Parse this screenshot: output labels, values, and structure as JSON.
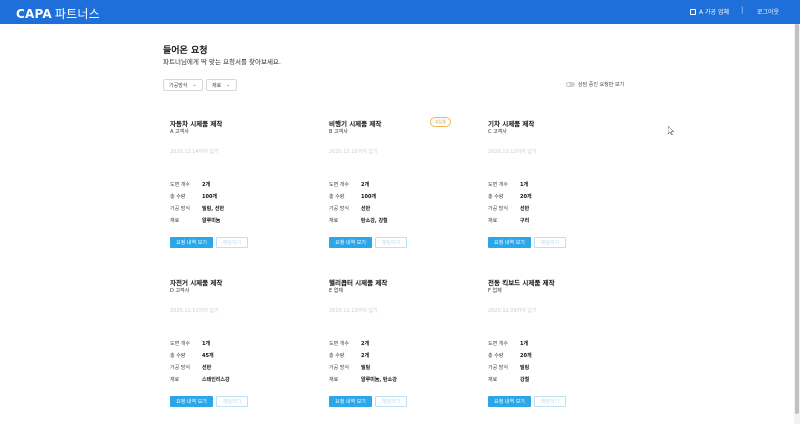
{
  "header": {
    "logo_main": "CAPA",
    "logo_sub": "파트너스",
    "company_label": "A 가공 업체",
    "separator": "|",
    "logout_label": "로그아웃"
  },
  "page": {
    "title": "들어온 요청",
    "subtitle": "파트너님에게 딱 맞는 요청서를 찾아보세요."
  },
  "filters": {
    "method_label": "가공방식",
    "material_label": "재료",
    "toggle_label": "상담 중인 요청만 보기"
  },
  "spec_labels": {
    "drawings": "도면 개수",
    "total_qty": "총 수량",
    "method": "가공 방식",
    "material": "재료"
  },
  "buttons": {
    "detail": "요청 내역 보기",
    "chat": "채팅하기"
  },
  "cards": [
    {
      "title": "자동차 시제품 제작",
      "client": "A 고객사",
      "date": "2020.12.14까지 납기",
      "badge": "",
      "drawings": "2개",
      "total_qty": "100개",
      "method": "밀링, 선반",
      "material": "알루미늄"
    },
    {
      "title": "비행기 시제품 제작",
      "client": "B 고객사",
      "date": "2020.12.15까지 납기",
      "badge": "상담중",
      "drawings": "2개",
      "total_qty": "100개",
      "method": "선반",
      "material": "탄소강, 강철"
    },
    {
      "title": "기차 시제품 제작",
      "client": "C 고객사",
      "date": "2020.12.12까지 납기",
      "badge": "",
      "drawings": "1개",
      "total_qty": "20개",
      "method": "선반",
      "material": "구리"
    },
    {
      "title": "자전거 시제품 제작",
      "client": "D 고객사",
      "date": "2020.12.11까지 납기",
      "badge": "",
      "drawings": "1개",
      "total_qty": "45개",
      "method": "선반",
      "material": "스테인리스강"
    },
    {
      "title": "헬리콥터 시제품 제작",
      "client": "E 업체",
      "date": "2020.12.15까지 납기",
      "badge": "",
      "drawings": "2개",
      "total_qty": "2개",
      "method": "밀링",
      "material": "알루미늄, 탄소강"
    },
    {
      "title": "전동 킥보드 시제품 제작",
      "client": "F 업체",
      "date": "2020.12.09까지 납기",
      "badge": "",
      "drawings": "1개",
      "total_qty": "20개",
      "method": "밀링",
      "material": "강철"
    }
  ]
}
